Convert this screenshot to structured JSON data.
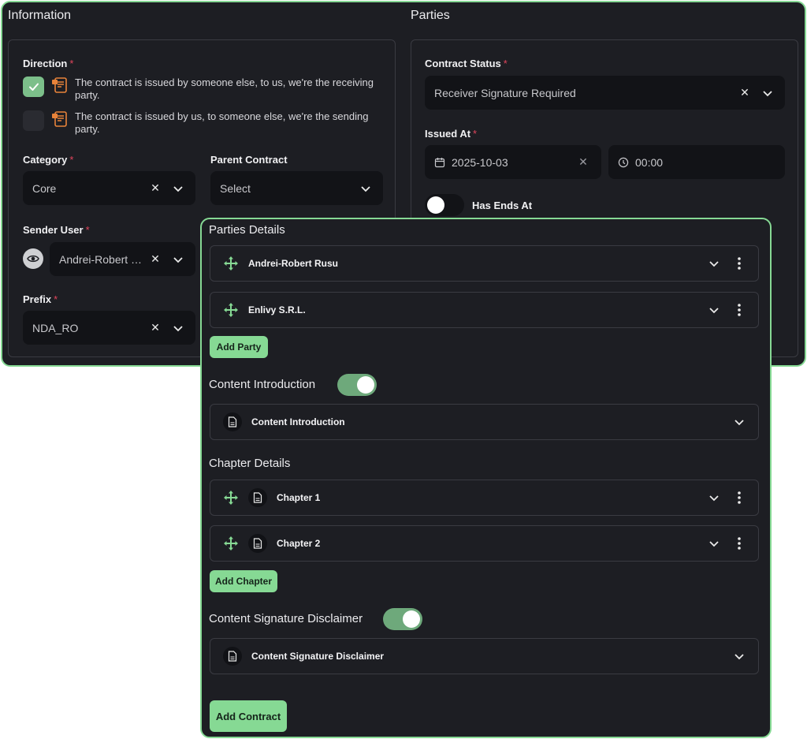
{
  "information": {
    "title": "Information",
    "direction": {
      "label": "Direction",
      "options": [
        {
          "text": "The contract is issued by someone else, to us, we're the receiving party.",
          "checked": true
        },
        {
          "text": "The contract is issued by us, to someone else, we're the sending party.",
          "checked": false
        }
      ]
    },
    "category": {
      "label": "Category",
      "value": "Core"
    },
    "parent_contract": {
      "label": "Parent Contract",
      "placeholder": "Select"
    },
    "sender_user": {
      "label": "Sender User",
      "value": "Andrei-Robert Rusu"
    },
    "prefix": {
      "label": "Prefix",
      "value": "NDA_RO"
    }
  },
  "parties": {
    "title": "Parties",
    "contract_status": {
      "label": "Contract Status",
      "value": "Receiver Signature Required"
    },
    "issued_at": {
      "label": "Issued At",
      "date": "2025-10-03",
      "time": "00:00"
    },
    "has_ends_at": {
      "label": "Has Ends At",
      "enabled": false
    }
  },
  "details": {
    "parties_title": "Parties Details",
    "parties": [
      "Andrei-Robert Rusu",
      "Enlivy S.R.L."
    ],
    "add_party_label": "Add Party",
    "content_intro": {
      "title": "Content Introduction",
      "enabled": true,
      "item": "Content Introduction"
    },
    "chapter_title": "Chapter Details",
    "chapters": [
      "Chapter 1",
      "Chapter 2"
    ],
    "add_chapter_label": "Add Chapter",
    "signature_disclaimer": {
      "title": "Content Signature Disclaimer",
      "enabled": true,
      "item": "Content Signature Disclaimer"
    },
    "add_contract_label": "Add Contract"
  },
  "colors": {
    "accent": "#86d994",
    "background": "#1d1e23",
    "field": "#121317",
    "required": "#e0455c"
  }
}
